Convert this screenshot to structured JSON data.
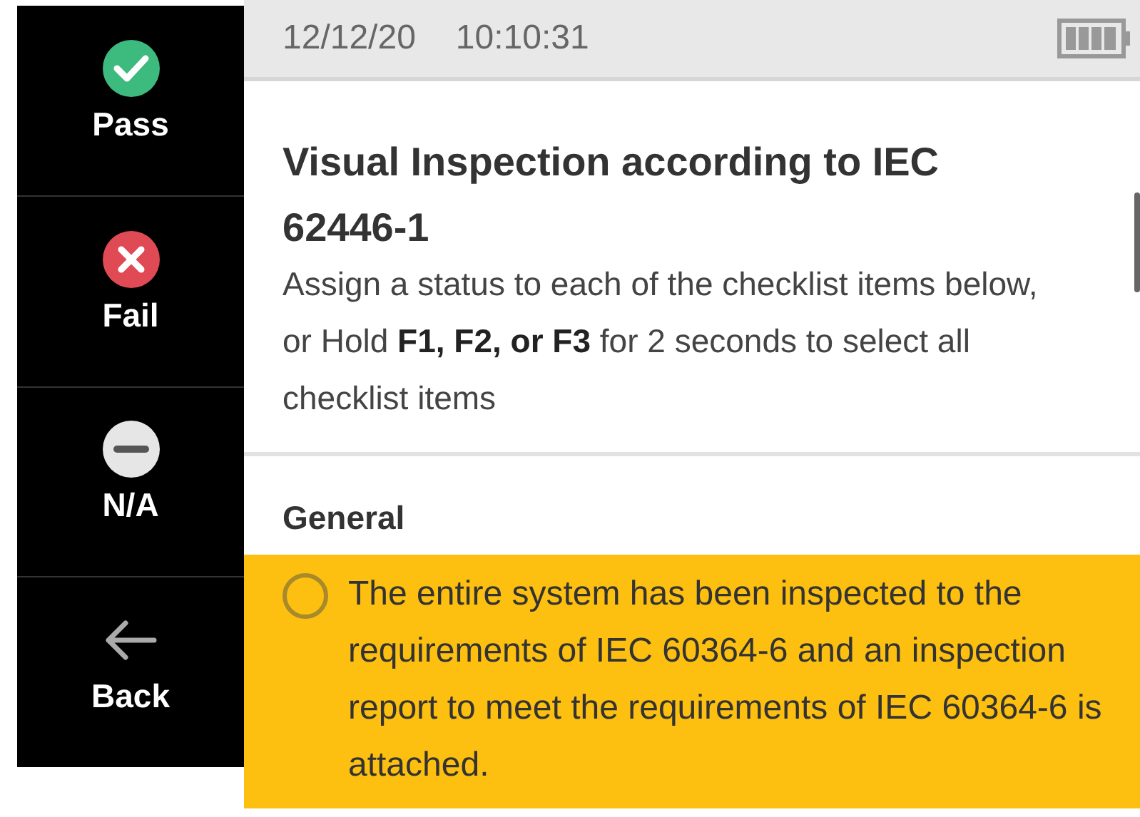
{
  "sidebar": {
    "buttons": [
      {
        "kind": "pass",
        "label": "Pass"
      },
      {
        "kind": "fail",
        "label": "Fail"
      },
      {
        "kind": "na",
        "label": "N/A"
      },
      {
        "kind": "back",
        "label": "Back"
      }
    ]
  },
  "status_bar": {
    "date": "12/12/20",
    "time": "10:10:31"
  },
  "header": {
    "title": "Visual Inspection according to IEC 62446-1",
    "description": "Assign a status to each of the checklist items below, or Hold **F1, F2, or F3** for 2 seconds to select all checklist items"
  },
  "sections": [
    {
      "title": "General",
      "items": [
        {
          "text": "The entire system has been inspected to the requirements of IEC 60364-6 and an inspection report to meet the requirements of IEC 60364-6 is attached.",
          "selected": true,
          "checked": false
        }
      ]
    }
  ]
}
